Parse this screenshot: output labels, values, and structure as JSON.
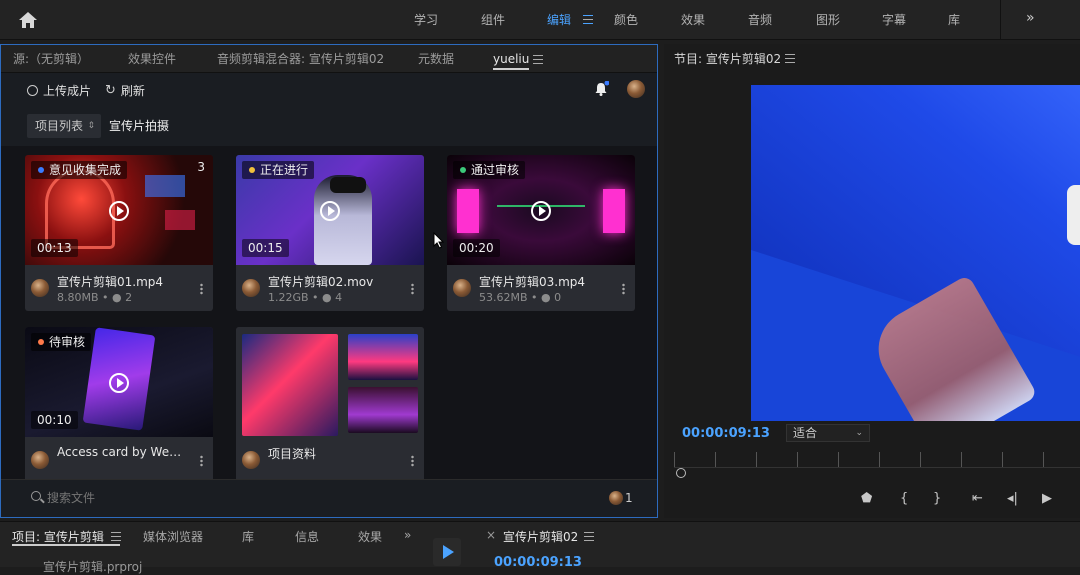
{
  "workspace": {
    "tabs": [
      "学习",
      "组件",
      "编辑",
      "颜色",
      "效果",
      "音频",
      "图形",
      "字幕",
      "库"
    ],
    "active": "编辑"
  },
  "left_panel": {
    "tabs": [
      "源:（无剪辑）",
      "效果控件",
      "音频剪辑混合器: 宣传片剪辑02",
      "元数据",
      "yueliu"
    ],
    "active_tab": "yueliu",
    "upload_label": "上传成片",
    "refresh_label": "刷新",
    "view_select": "项目列表",
    "breadcrumb": "宣传片拍摄",
    "cards": [
      {
        "status": "意见收集完成",
        "status_color": "#3a7bff",
        "count": "3",
        "duration": "00:13",
        "name": "宣传片剪辑01.mp4",
        "size": "8.80MB",
        "comments": "2"
      },
      {
        "status": "正在进行",
        "status_color": "#f0c03c",
        "count": "",
        "duration": "00:15",
        "name": "宣传片剪辑02.mov",
        "size": "1.22GB",
        "comments": "4"
      },
      {
        "status": "通过审核",
        "status_color": "#3cc87a",
        "count": "",
        "duration": "00:20",
        "name": "宣传片剪辑03.mp4",
        "size": "53.62MB",
        "comments": "0"
      },
      {
        "status": "待审核",
        "status_color": "#ff7a4a",
        "count": "",
        "duration": "00:10",
        "name": "Access card by Webs…",
        "size": "",
        "comments": ""
      },
      {
        "status": "",
        "status_color": "",
        "count": "",
        "duration": "",
        "name": "项目资料",
        "size": "",
        "comments": ""
      }
    ],
    "search_placeholder": "搜索文件",
    "user_count": "1"
  },
  "program_monitor": {
    "title": "节目: 宣传片剪辑02",
    "timecode": "00:00:09:13",
    "fit": "适合"
  },
  "bottom": {
    "tabs": [
      "项目: 宣传片剪辑",
      "媒体浏览器",
      "库",
      "信息",
      "效果"
    ],
    "project_file": "宣传片剪辑.prproj",
    "seq_title": "宣传片剪辑02",
    "seq_timecode": "00:00:09:13"
  }
}
